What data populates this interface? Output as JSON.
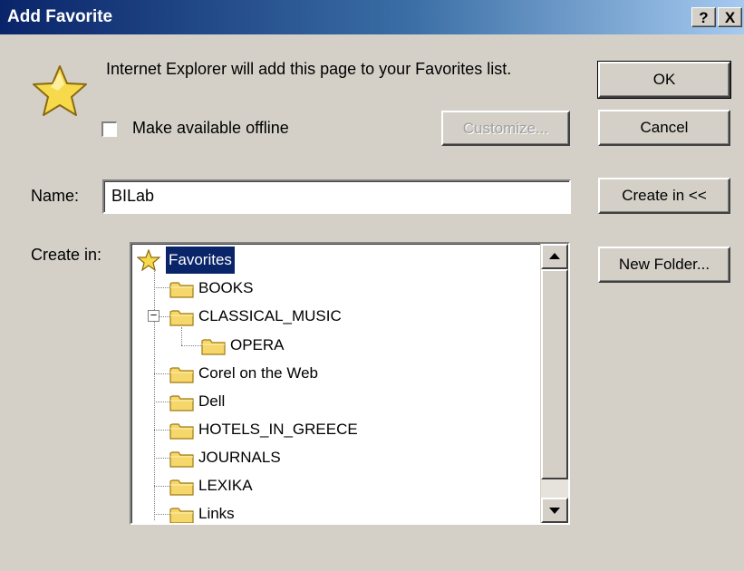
{
  "window": {
    "title": "Add Favorite",
    "help_btn": "?",
    "close_btn": "X"
  },
  "message": "Internet Explorer will add this page to your Favorites list.",
  "offline": {
    "label": "Make available offline",
    "checked": false
  },
  "buttons": {
    "customize": "Customize...",
    "ok": "OK",
    "cancel": "Cancel",
    "create_in": "Create in <<",
    "new_folder": "New Folder..."
  },
  "name_field": {
    "label": "Name:",
    "value": "BILab"
  },
  "create_in": {
    "label": "Create in:",
    "root": "Favorites",
    "items": [
      {
        "label": "BOOKS"
      },
      {
        "label": "CLASSICAL_MUSIC",
        "expanded": true
      },
      {
        "label": "OPERA"
      },
      {
        "label": "Corel on the Web"
      },
      {
        "label": "Dell"
      },
      {
        "label": "HOTELS_IN_GREECE"
      },
      {
        "label": "JOURNALS"
      },
      {
        "label": "LEXIKA"
      },
      {
        "label": "Links"
      }
    ],
    "expander_symbol": "−"
  },
  "colors": {
    "titlebar": "#0a246a",
    "selection": "#0a246a",
    "dialog": "#d4d0c8",
    "folder": "#f6d76b",
    "star": "#f7d94c"
  },
  "icons": {
    "star": "star-icon",
    "folder": "folder-icon",
    "scroll_up": "up-arrow-icon",
    "scroll_down": "down-arrow-icon"
  }
}
